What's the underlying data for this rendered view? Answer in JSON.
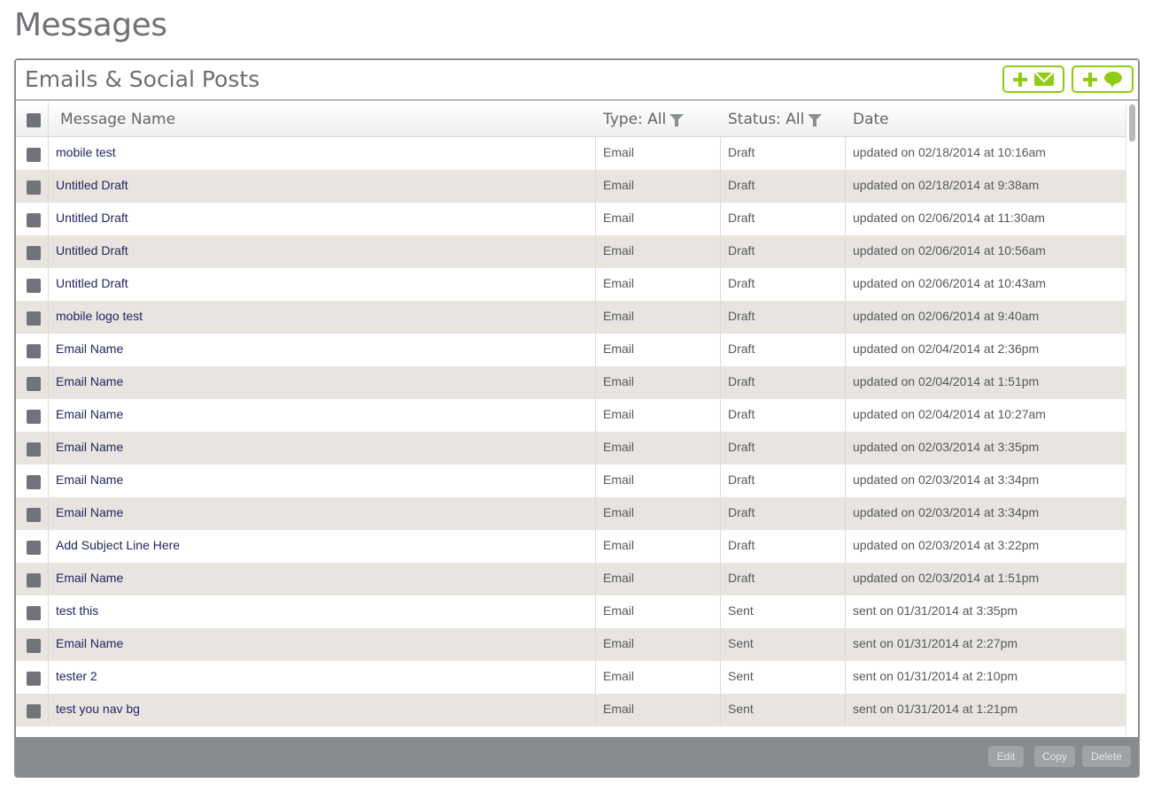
{
  "page": {
    "title": "Messages"
  },
  "panel": {
    "title": "Emails & Social Posts",
    "add_email_icon": "plus-envelope-icon",
    "add_social_icon": "plus-speech-bubble-icon",
    "accent_color": "#8fcc10"
  },
  "columns": {
    "name": "Message Name",
    "type": "Type: All",
    "status": "Status: All",
    "date": "Date"
  },
  "rows": [
    {
      "name": "mobile test",
      "type": "Email",
      "status": "Draft",
      "date": "updated on 02/18/2014 at 10:16am"
    },
    {
      "name": "Untitled Draft",
      "type": "Email",
      "status": "Draft",
      "date": "updated on 02/18/2014 at 9:38am"
    },
    {
      "name": "Untitled Draft",
      "type": "Email",
      "status": "Draft",
      "date": "updated on 02/06/2014 at 11:30am"
    },
    {
      "name": "Untitled Draft",
      "type": "Email",
      "status": "Draft",
      "date": "updated on 02/06/2014 at 10:56am"
    },
    {
      "name": "Untitled Draft",
      "type": "Email",
      "status": "Draft",
      "date": "updated on 02/06/2014 at 10:43am"
    },
    {
      "name": "mobile logo test",
      "type": "Email",
      "status": "Draft",
      "date": "updated on 02/06/2014 at 9:40am"
    },
    {
      "name": "Email Name",
      "type": "Email",
      "status": "Draft",
      "date": "updated on 02/04/2014 at 2:36pm"
    },
    {
      "name": "Email Name",
      "type": "Email",
      "status": "Draft",
      "date": "updated on 02/04/2014 at 1:51pm"
    },
    {
      "name": "Email Name",
      "type": "Email",
      "status": "Draft",
      "date": "updated on 02/04/2014 at 10:27am"
    },
    {
      "name": "Email Name",
      "type": "Email",
      "status": "Draft",
      "date": "updated on 02/03/2014 at 3:35pm"
    },
    {
      "name": "Email Name",
      "type": "Email",
      "status": "Draft",
      "date": "updated on 02/03/2014 at 3:34pm"
    },
    {
      "name": "Email Name",
      "type": "Email",
      "status": "Draft",
      "date": "updated on 02/03/2014 at 3:34pm"
    },
    {
      "name": "Add Subject Line Here",
      "type": "Email",
      "status": "Draft",
      "date": "updated on 02/03/2014 at 3:22pm"
    },
    {
      "name": "Email Name",
      "type": "Email",
      "status": "Draft",
      "date": "updated on 02/03/2014 at 1:51pm"
    },
    {
      "name": "test this",
      "type": "Email",
      "status": "Sent",
      "date": "sent on 01/31/2014 at 3:35pm"
    },
    {
      "name": "Email Name",
      "type": "Email",
      "status": "Sent",
      "date": "sent on 01/31/2014 at 2:27pm"
    },
    {
      "name": "tester 2",
      "type": "Email",
      "status": "Sent",
      "date": "sent on 01/31/2014 at 2:10pm"
    },
    {
      "name": "test you nav bg",
      "type": "Email",
      "status": "Sent",
      "date": "sent on 01/31/2014 at 1:21pm"
    }
  ],
  "footer": {
    "edit": "Edit",
    "copy": "Copy",
    "delete": "Delete"
  }
}
